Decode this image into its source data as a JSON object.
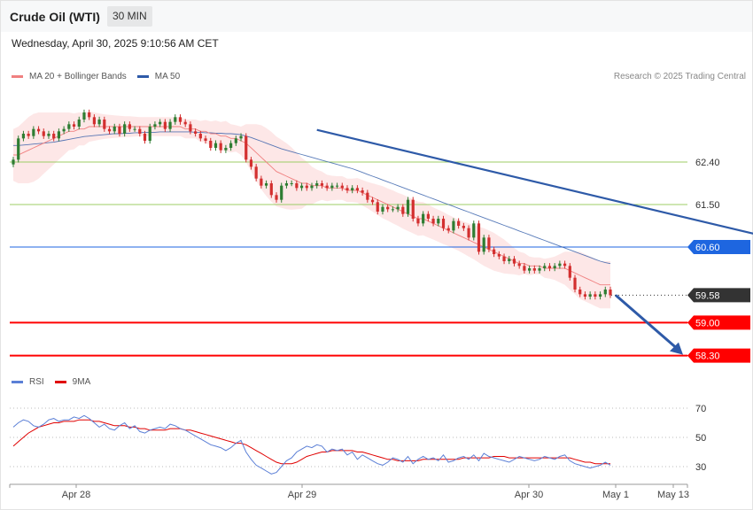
{
  "header": {
    "title": "Crude Oil (WTI)",
    "timeframe": "30 MIN",
    "datetime": "Wednesday, April 30, 2025 9:10:56 AM CET",
    "credit": "Research © 2025 Trading Central"
  },
  "legend_main": [
    {
      "label": "MA 20 + Bollinger Bands",
      "color": "#f08080"
    },
    {
      "label": "MA 50",
      "color": "#2e5aa8"
    }
  ],
  "legend_rsi": [
    {
      "label": "RSI",
      "color": "#5b7fd6"
    },
    {
      "label": "9MA",
      "color": "#e00000"
    }
  ],
  "colors": {
    "up": "#2e7d32",
    "down": "#d32f2f",
    "support": "#ff0000",
    "resistance_green": "#9ccc65",
    "pivot": "#1e66e0",
    "arrow": "#2e5aa8",
    "band_fill": "#fde3e3"
  },
  "chart_data": {
    "type": "candlestick",
    "ylim": [
      57.9,
      63.7
    ],
    "x_ticks": [
      "Apr 28",
      "Apr 29",
      "Apr 30",
      "May 1",
      "May 13"
    ],
    "levels": [
      {
        "label": "62.40",
        "value": 62.4,
        "style": "green"
      },
      {
        "label": "61.50",
        "value": 61.5,
        "style": "green"
      },
      {
        "label": "60.60",
        "value": 60.6,
        "style": "pivot"
      },
      {
        "label": "59.58",
        "value": 59.58,
        "style": "last"
      },
      {
        "label": "59.00",
        "value": 59.0,
        "style": "support"
      },
      {
        "label": "58.30",
        "value": 58.3,
        "style": "support"
      }
    ],
    "close": [
      62.45,
      62.9,
      63.0,
      62.95,
      63.1,
      63.05,
      62.95,
      63.0,
      62.9,
      63.05,
      63.1,
      63.2,
      63.15,
      63.3,
      63.45,
      63.35,
      63.2,
      63.3,
      63.1,
      63.05,
      63.15,
      63.0,
      63.2,
      63.1,
      63.1,
      63.0,
      62.85,
      63.15,
      63.2,
      63.25,
      63.1,
      63.25,
      63.35,
      63.25,
      63.2,
      63.05,
      63.0,
      62.9,
      62.85,
      62.7,
      62.8,
      62.65,
      62.7,
      62.8,
      62.9,
      62.95,
      62.45,
      62.3,
      62.05,
      61.9,
      61.95,
      61.7,
      61.6,
      61.9,
      61.95,
      61.95,
      61.85,
      61.9,
      61.85,
      61.9,
      61.95,
      61.9,
      61.85,
      61.9,
      61.9,
      61.85,
      61.8,
      61.85,
      61.8,
      61.75,
      61.6,
      61.55,
      61.35,
      61.45,
      61.4,
      61.4,
      61.45,
      61.3,
      61.6,
      61.2,
      61.1,
      61.3,
      61.2,
      61.1,
      61.2,
      61.0,
      60.95,
      61.15,
      61.05,
      61.0,
      60.8,
      61.1,
      60.5,
      60.8,
      60.55,
      60.45,
      60.4,
      60.3,
      60.35,
      60.25,
      60.2,
      60.1,
      60.15,
      60.1,
      60.15,
      60.2,
      60.15,
      60.2,
      60.25,
      60.2,
      59.95,
      59.7,
      59.6,
      59.55,
      59.6,
      59.55,
      59.6,
      59.7,
      59.58
    ],
    "ma20": [
      62.55,
      62.55,
      62.6,
      62.65,
      62.7,
      62.75,
      62.8,
      62.85,
      62.9,
      62.95,
      63.0,
      63.05,
      63.05,
      63.1,
      63.1,
      63.15,
      63.15,
      63.15,
      63.15,
      63.15,
      63.15,
      63.15,
      63.15,
      63.15,
      63.15,
      63.15,
      63.15,
      63.15,
      63.15,
      63.15,
      63.15,
      63.15,
      63.15,
      63.15,
      63.1,
      63.1,
      63.1,
      63.05,
      63.05,
      63.0,
      63.0,
      62.95,
      62.95,
      62.9,
      62.9,
      62.85,
      62.8,
      62.7,
      62.6,
      62.5,
      62.4,
      62.3,
      62.2,
      62.15,
      62.1,
      62.05,
      62.0,
      61.95,
      61.95,
      61.9,
      61.9,
      61.9,
      61.85,
      61.85,
      61.85,
      61.85,
      61.8,
      61.8,
      61.8,
      61.75,
      61.7,
      61.65,
      61.6,
      61.55,
      61.5,
      61.45,
      61.4,
      61.35,
      61.3,
      61.25,
      61.2,
      61.2,
      61.15,
      61.1,
      61.05,
      61.0,
      60.95,
      60.9,
      60.85,
      60.8,
      60.75,
      60.7,
      60.65,
      60.6,
      60.55,
      60.5,
      60.45,
      60.4,
      60.35,
      60.3,
      60.25,
      60.25,
      60.2,
      60.2,
      60.2,
      60.15,
      60.15,
      60.15,
      60.15,
      60.15,
      60.1,
      60.05,
      60.0,
      59.95,
      59.9,
      59.85,
      59.8,
      59.8,
      59.8
    ],
    "ma50": [
      62.75,
      62.75,
      62.76,
      62.77,
      62.78,
      62.79,
      62.8,
      62.81,
      62.82,
      62.84,
      62.86,
      62.88,
      62.9,
      62.92,
      62.94,
      62.95,
      62.96,
      62.97,
      62.98,
      62.99,
      63.0,
      63.0,
      63.01,
      63.01,
      63.02,
      63.02,
      63.03,
      63.03,
      63.03,
      63.04,
      63.04,
      63.04,
      63.04,
      63.04,
      63.04,
      63.04,
      63.03,
      63.03,
      63.02,
      63.02,
      63.01,
      63.01,
      63.0,
      63.0,
      62.99,
      62.98,
      62.95,
      62.92,
      62.88,
      62.84,
      62.8,
      62.76,
      62.72,
      62.68,
      62.65,
      62.62,
      62.59,
      62.56,
      62.53,
      62.5,
      62.47,
      62.44,
      62.41,
      62.38,
      62.35,
      62.32,
      62.29,
      62.26,
      62.22,
      62.18,
      62.14,
      62.1,
      62.06,
      62.02,
      61.98,
      61.94,
      61.9,
      61.86,
      61.82,
      61.78,
      61.74,
      61.7,
      61.66,
      61.62,
      61.58,
      61.54,
      61.5,
      61.46,
      61.42,
      61.38,
      61.34,
      61.3,
      61.26,
      61.22,
      61.18,
      61.14,
      61.1,
      61.06,
      61.02,
      60.98,
      60.94,
      60.9,
      60.86,
      60.82,
      60.78,
      60.74,
      60.7,
      60.66,
      60.62,
      60.58,
      60.54,
      60.5,
      60.46,
      60.42,
      60.38,
      60.34,
      60.3,
      60.27,
      60.25
    ],
    "band_width": [
      0.55,
      0.6,
      0.65,
      0.7,
      0.72,
      0.7,
      0.65,
      0.6,
      0.55,
      0.5,
      0.45,
      0.4,
      0.38,
      0.35,
      0.35,
      0.32,
      0.3,
      0.28,
      0.26,
      0.25,
      0.24,
      0.23,
      0.22,
      0.22,
      0.21,
      0.2,
      0.2,
      0.2,
      0.2,
      0.2,
      0.2,
      0.2,
      0.2,
      0.2,
      0.2,
      0.2,
      0.2,
      0.22,
      0.24,
      0.26,
      0.28,
      0.3,
      0.32,
      0.3,
      0.28,
      0.3,
      0.4,
      0.5,
      0.6,
      0.68,
      0.72,
      0.74,
      0.74,
      0.72,
      0.7,
      0.66,
      0.6,
      0.54,
      0.46,
      0.4,
      0.34,
      0.3,
      0.28,
      0.26,
      0.25,
      0.25,
      0.25,
      0.25,
      0.26,
      0.27,
      0.28,
      0.3,
      0.32,
      0.34,
      0.34,
      0.35,
      0.35,
      0.36,
      0.36,
      0.36,
      0.36,
      0.35,
      0.35,
      0.34,
      0.34,
      0.34,
      0.33,
      0.33,
      0.33,
      0.34,
      0.35,
      0.36,
      0.38,
      0.4,
      0.4,
      0.4,
      0.38,
      0.36,
      0.32,
      0.28,
      0.25,
      0.22,
      0.2,
      0.18,
      0.18,
      0.2,
      0.22,
      0.25,
      0.3,
      0.35,
      0.4,
      0.45,
      0.5,
      0.5,
      0.5,
      0.5,
      0.5,
      0.5,
      0.5
    ],
    "trendline": {
      "start": [
        60,
        63.08
      ],
      "end": [
        168,
        60.33
      ]
    },
    "projection": {
      "from": 59.6,
      "to": 58.3
    },
    "rsi_ylim": [
      20,
      80
    ],
    "rsi_ticks": [
      70,
      50,
      30
    ],
    "rsi": [
      57,
      60,
      62,
      61,
      58,
      57,
      59,
      62,
      63,
      61,
      62,
      62,
      64,
      63,
      65,
      63,
      60,
      57,
      59,
      56,
      55,
      58,
      60,
      56,
      58,
      54,
      53,
      55,
      56,
      57,
      56,
      59,
      58,
      56,
      55,
      53,
      51,
      49,
      47,
      45,
      44,
      43,
      41,
      43,
      46,
      48,
      40,
      35,
      31,
      29,
      27,
      25,
      26,
      30,
      34,
      36,
      40,
      42,
      44,
      43,
      45,
      44,
      40,
      42,
      41,
      42,
      38,
      40,
      35,
      38,
      36,
      34,
      32,
      31,
      33,
      36,
      35,
      33,
      37,
      32,
      35,
      37,
      35,
      36,
      34,
      38,
      33,
      34,
      36,
      37,
      35,
      38,
      34,
      39,
      37,
      36,
      35,
      34,
      33,
      35,
      37,
      36,
      35,
      34,
      35,
      37,
      36,
      35,
      37,
      38,
      34,
      32,
      31,
      30,
      29,
      30,
      31,
      33,
      31
    ],
    "rsi_ma": [
      44,
      47,
      50,
      53,
      55,
      57,
      58,
      59,
      60,
      60,
      61,
      61,
      61,
      62,
      62,
      62,
      61,
      61,
      60,
      59,
      58,
      58,
      58,
      57,
      57,
      56,
      56,
      55,
      55,
      55,
      55,
      56,
      56,
      56,
      55,
      55,
      54,
      53,
      52,
      51,
      50,
      49,
      48,
      47,
      46,
      46,
      45,
      43,
      41,
      39,
      37,
      35,
      33,
      32,
      32,
      32,
      33,
      35,
      37,
      38,
      39,
      40,
      40,
      41,
      41,
      41,
      41,
      41,
      40,
      40,
      39,
      38,
      37,
      36,
      35,
      35,
      34,
      34,
      34,
      34,
      34,
      35,
      35,
      35,
      35,
      35,
      35,
      35,
      35,
      36,
      36,
      36,
      36,
      36,
      36,
      37,
      37,
      37,
      36,
      36,
      36,
      36,
      36,
      36,
      36,
      36,
      36,
      36,
      36,
      36,
      36,
      35,
      34,
      33,
      33,
      32,
      32,
      32,
      32
    ]
  }
}
